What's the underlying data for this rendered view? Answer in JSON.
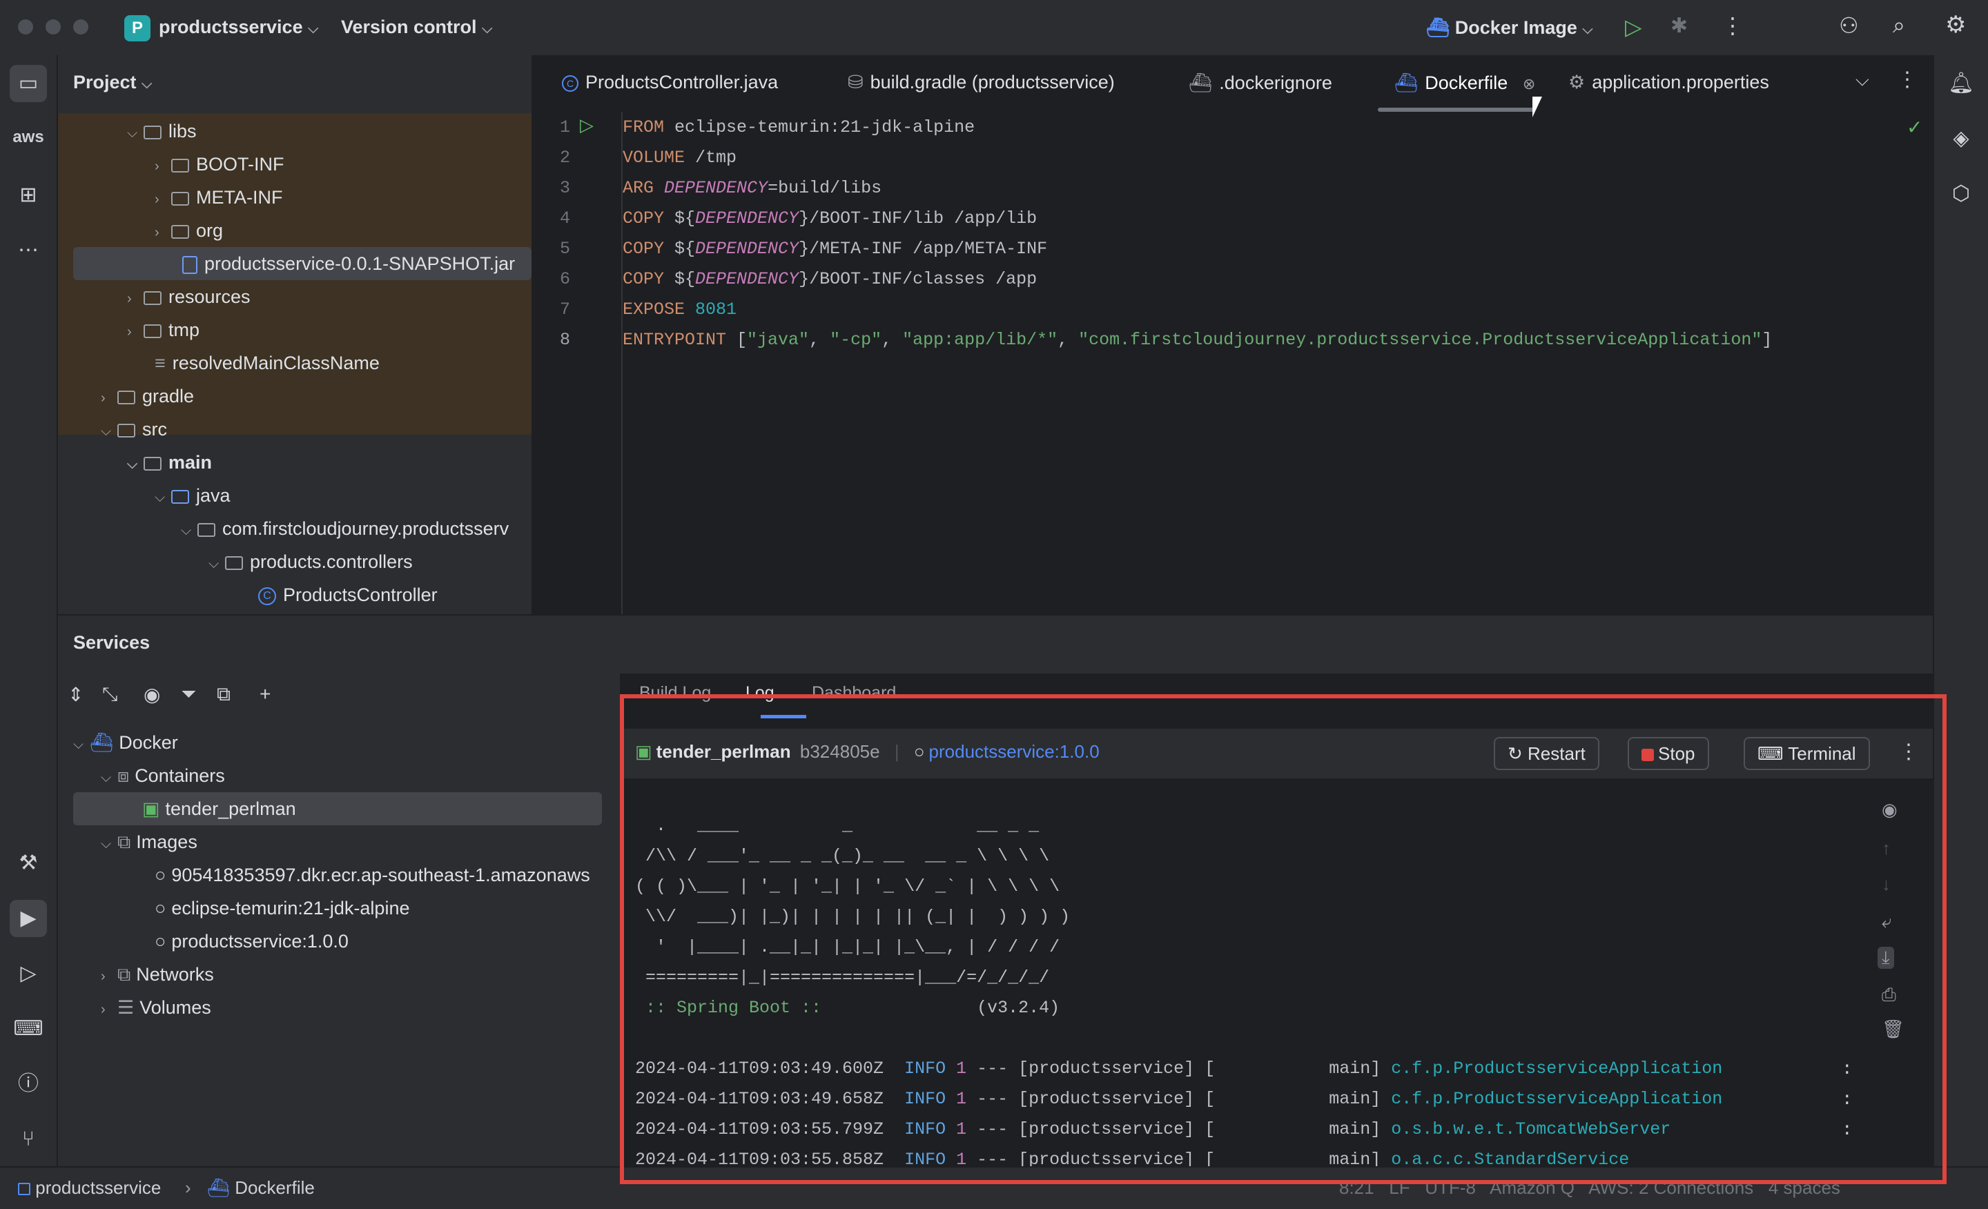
{
  "window": {
    "project_badge": "P",
    "project_name": "productsservice",
    "version_control": "Version control",
    "run_config": "Docker Image"
  },
  "project_panel": {
    "title": "Project",
    "tree": [
      {
        "label": "libs",
        "type": "folder"
      },
      {
        "label": "BOOT-INF",
        "type": "folder"
      },
      {
        "label": "META-INF",
        "type": "folder"
      },
      {
        "label": "org",
        "type": "folder"
      },
      {
        "label": "productsservice-0.0.1-SNAPSHOT.jar",
        "type": "jar"
      },
      {
        "label": "resources",
        "type": "folder"
      },
      {
        "label": "tmp",
        "type": "folder"
      },
      {
        "label": "resolvedMainClassName",
        "type": "file"
      },
      {
        "label": "gradle",
        "type": "folder"
      },
      {
        "label": "src",
        "type": "folder"
      },
      {
        "label": "main",
        "type": "folder"
      },
      {
        "label": "java",
        "type": "folder"
      },
      {
        "label": "com.firstcloudjourney.productsserv",
        "type": "package"
      },
      {
        "label": "products.controllers",
        "type": "package"
      },
      {
        "label": "ProductsController",
        "type": "class"
      }
    ]
  },
  "editor": {
    "tabs": [
      {
        "label": "ProductsController.java"
      },
      {
        "label": "build.gradle (productsservice)"
      },
      {
        "label": ".dockerignore"
      },
      {
        "label": "Dockerfile",
        "active": true
      },
      {
        "label": "application.properties"
      }
    ],
    "lines": [
      "FROM eclipse-temurin:21-jdk-alpine",
      "VOLUME /tmp",
      "ARG DEPENDENCY=build/libs",
      "COPY ${DEPENDENCY}/BOOT-INF/lib /app/lib",
      "COPY ${DEPENDENCY}/META-INF /app/META-INF",
      "COPY ${DEPENDENCY}/BOOT-INF/classes /app",
      "EXPOSE 8081",
      "ENTRYPOINT [\"java\", \"-cp\", \"app:app/lib/*\", \"com.firstcloudjourney.productsservice.ProductsserviceApplication\"]"
    ],
    "line_numbers": [
      "1",
      "2",
      "3",
      "4",
      "5",
      "6",
      "7",
      "8"
    ],
    "code": {
      "l1_kw": "FROM",
      "l1_rest": " eclipse-temurin:21-jdk-alpine",
      "l2_kw": "VOLUME",
      "l2_rest": " /tmp",
      "l3_kw": "ARG",
      "l3_var": "DEPENDENCY",
      "l3_rest": "=build/libs",
      "l4_kw": "COPY",
      "l4_a": " ${",
      "l4_var": "DEPENDENCY",
      "l4_rest": "}/BOOT-INF/lib /app/lib",
      "l5_kw": "COPY",
      "l5_a": " ${",
      "l5_var": "DEPENDENCY",
      "l5_rest": "}/META-INF /app/META-INF",
      "l6_kw": "COPY",
      "l6_a": " ${",
      "l6_var": "DEPENDENCY",
      "l6_rest": "}/BOOT-INF/classes /app",
      "l7_kw": "EXPOSE",
      "l7_sp": " ",
      "l7_num": "8081",
      "l8_kw": "ENTRYPOINT",
      "l8_a": " [",
      "l8_s1": "\"java\"",
      "l8_c1": ", ",
      "l8_s2": "\"-cp\"",
      "l8_c2": ", ",
      "l8_s3": "\"app:app/lib/*\"",
      "l8_c3": ", ",
      "l8_s4": "\"com.firstcloudjourney.productsservice.ProductsserviceApplication\"",
      "l8_end": "]"
    }
  },
  "services": {
    "title": "Services",
    "tree": {
      "docker": "Docker",
      "containers": "Containers",
      "container_item": "tender_perlman",
      "images": "Images",
      "image_items": [
        "905418353597.dkr.ecr.ap-southeast-1.amazonaws",
        "eclipse-temurin:21-jdk-alpine",
        "productsservice:1.0.0"
      ],
      "networks": "Networks",
      "volumes": "Volumes"
    },
    "subtabs": [
      "Build Log",
      "Log",
      "Dashboard"
    ],
    "container": {
      "name": "tender_perlman",
      "id": "b324805e",
      "image": "productsservice:1.0.0",
      "restart": "Restart",
      "stop": "Stop",
      "terminal": "Terminal"
    },
    "console": {
      "banner": [
        "  .   ____          _            __ _ _",
        " /\\\\ / ___'_ __ _ _(_)_ __  __ _ \\ \\ \\ \\",
        "( ( )\\___ | '_ | '_| | '_ \\/ _` | \\ \\ \\ \\",
        " \\\\/  ___)| |_)| | | | | || (_| |  ) ) ) )",
        "  '  |____| .__|_| |_|_| |_\\__, | / / / /",
        " =========|_|==============|___/=/_/_/_/"
      ],
      "spring_label": " :: Spring Boot ::",
      "spring_version": "(v3.2.4)",
      "log_lines": [
        {
          "ts": "2024-04-11T09:03:49.600Z",
          "level": "INFO",
          "pid": "1",
          "mid": " --- [productsservice] [           main] ",
          "logger": "c.f.p.ProductsserviceApplication"
        },
        {
          "ts": "2024-04-11T09:03:49.658Z",
          "level": "INFO",
          "pid": "1",
          "mid": " --- [productsservice] [           main] ",
          "logger": "c.f.p.ProductsserviceApplication"
        },
        {
          "ts": "2024-04-11T09:03:55.799Z",
          "level": "INFO",
          "pid": "1",
          "mid": " --- [productsservice] [           main] ",
          "logger": "o.s.b.w.e.t.TomcatWebServer"
        },
        {
          "ts": "2024-04-11T09:03:55.858Z",
          "level": "INFO",
          "pid": "1",
          "mid": " --- [productsservice] [           main] ",
          "logger": "o.a.c.c.StandardService"
        }
      ]
    }
  },
  "statusbar": {
    "crumb_project": "productsservice",
    "crumb_file": "Dockerfile",
    "right_text": "8:21   LF   UTF-8   Amazon Q   AWS: 2 Connections   4 spaces"
  },
  "colors": {
    "highlight": "#e0443e",
    "accent": "#548af7"
  }
}
